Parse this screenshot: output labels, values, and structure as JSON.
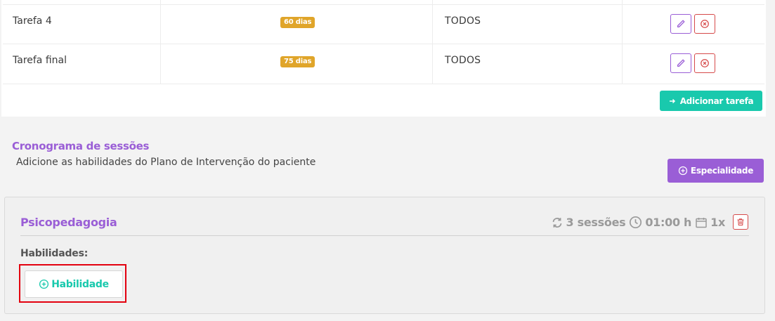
{
  "tasks": {
    "rows": [
      {
        "name": "Tarefa 4",
        "duration": "60 dias",
        "target": "TODOS"
      },
      {
        "name": "Tarefa final",
        "duration": "75 dias",
        "target": "TODOS"
      }
    ],
    "add_button_label": "Adicionar tarefa"
  },
  "schedule": {
    "title": "Cronograma de sessões",
    "subtitle": "Adicione as habilidades do Plano de Intervenção do paciente",
    "add_specialty_label": "Especialidade",
    "specialty": {
      "name": "Psicopedagogia",
      "sessions": "3 sessões",
      "duration": "01:00 h",
      "frequency": "1x",
      "skills_label": "Habilidades:",
      "add_skill_label": "Habilidade"
    }
  },
  "colors": {
    "accent_purple": "#9a5ed6",
    "accent_teal": "#19c9ad",
    "badge_orange": "#e0a52a",
    "danger_red": "#d64a4a"
  }
}
